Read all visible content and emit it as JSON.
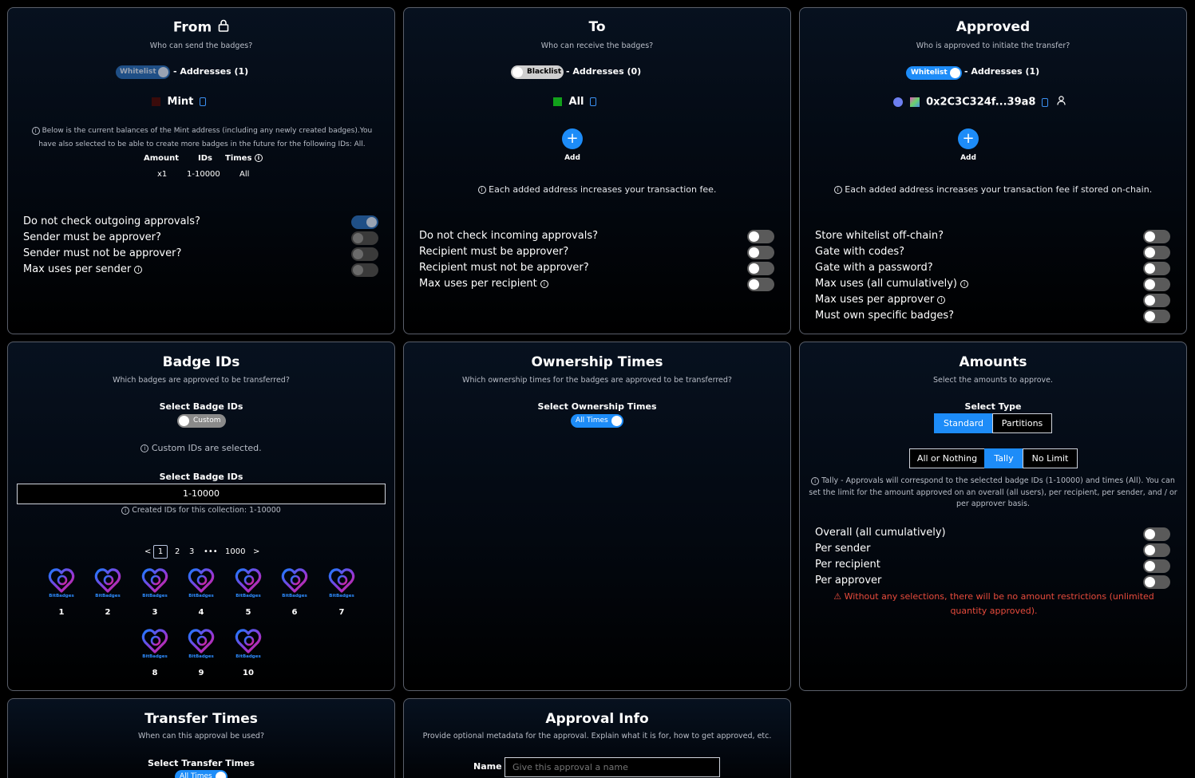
{
  "from": {
    "title": "From",
    "subtitle": "Who can send the badges?",
    "list_type": "Whitelist",
    "addresses_label": "- Addresses (1)",
    "address": "Mint",
    "info_text": "Below is the current balances of the Mint address (including any newly created badges).You have also selected to be able to create more badges in the future for the following IDs: All.",
    "table_headers": [
      "Amount",
      "IDs",
      "Times"
    ],
    "table_row": [
      "x1",
      "1-10000",
      "All"
    ],
    "options": [
      {
        "label": "Do not check outgoing approvals?",
        "on": true
      },
      {
        "label": "Sender must be approver?",
        "on": false
      },
      {
        "label": "Sender must not be approver?",
        "on": false
      },
      {
        "label": "Max uses per sender",
        "on": false
      }
    ]
  },
  "to": {
    "title": "To",
    "subtitle": "Who can receive the badges?",
    "list_type": "Blacklist",
    "addresses_label": "- Addresses (0)",
    "address": "All",
    "add_label": "Add",
    "fee_note": "Each added address increases your transaction fee.",
    "options": [
      {
        "label": "Do not check incoming approvals?",
        "on": false
      },
      {
        "label": "Recipient must be approver?",
        "on": false
      },
      {
        "label": "Recipient must not be approver?",
        "on": false
      },
      {
        "label": "Max uses per recipient",
        "on": false
      }
    ]
  },
  "approved": {
    "title": "Approved",
    "subtitle": "Who is approved to initiate the transfer?",
    "list_type": "Whitelist",
    "addresses_label": "- Addresses (1)",
    "address": "0x2C3C324f...39a8",
    "add_label": "Add",
    "fee_note": "Each added address increases your transaction fee if stored on-chain.",
    "options": [
      {
        "label": "Store whitelist off-chain?",
        "on": false
      },
      {
        "label": "Gate with codes?",
        "on": false
      },
      {
        "label": "Gate with a password?",
        "on": false
      },
      {
        "label": "Max uses (all cumulatively)",
        "on": false
      },
      {
        "label": "Max uses per approver",
        "on": false
      },
      {
        "label": "Must own specific badges?",
        "on": false
      }
    ]
  },
  "badge_ids": {
    "title": "Badge IDs",
    "subtitle": "Which badges are approved to be transferred?",
    "select_label": "Select Badge IDs",
    "mode": "Custom",
    "mode_note": "Custom IDs are selected.",
    "input_label": "Select Badge IDs",
    "input_value": "1-10000",
    "created_note": "Created IDs for this collection: 1-10000",
    "pagination": [
      "<",
      "1",
      "2",
      "3",
      "•••",
      "1000",
      ">"
    ],
    "logo_text": "BitBadges",
    "badges": [
      "1",
      "2",
      "3",
      "4",
      "5",
      "6",
      "7",
      "8",
      "9",
      "10"
    ]
  },
  "ownership_times": {
    "title": "Ownership Times",
    "subtitle": "Which ownership times for the badges are approved to be transferred?",
    "select_label": "Select Ownership Times",
    "mode": "All Times"
  },
  "amounts": {
    "title": "Amounts",
    "subtitle": "Select the amounts to approve.",
    "select_label": "Select Type",
    "types": [
      "Standard",
      "Partitions"
    ],
    "modes": [
      "All or Nothing",
      "Tally",
      "No Limit"
    ],
    "info_text": "Tally - Approvals will correspond to the selected badge IDs (1-10000) and times (All). You can set the limit for the amount approved on an overall (all users), per recipient, per sender, and / or per approver basis.",
    "options": [
      {
        "label": "Overall (all cumulatively)",
        "on": false
      },
      {
        "label": "Per sender",
        "on": false
      },
      {
        "label": "Per recipient",
        "on": false
      },
      {
        "label": "Per approver",
        "on": false
      }
    ],
    "warning": "Without any selections, there will be no amount restrictions (unlimited quantity approved)."
  },
  "transfer_times": {
    "title": "Transfer Times",
    "subtitle": "When can this approval be used?",
    "select_label": "Select Transfer Times",
    "mode": "All Times"
  },
  "approval_info": {
    "title": "Approval Info",
    "subtitle": "Provide optional metadata for the approval. Explain what it is for, how to get approved, etc.",
    "name_label": "Name",
    "name_placeholder": "Give this approval a name"
  },
  "colors": {
    "accent": "#1d8cf8",
    "warning": "#e84b3c",
    "toggle_off": "#5a5a5a"
  }
}
